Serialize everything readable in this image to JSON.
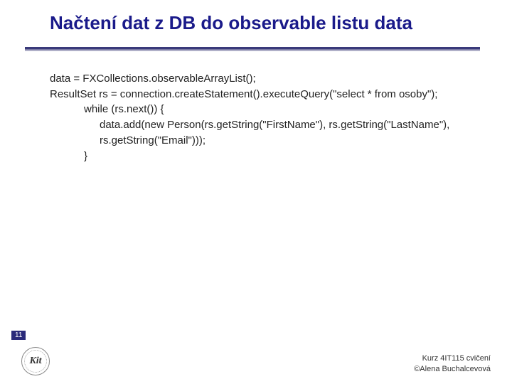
{
  "title": "Načtení dat z DB do observable listu data",
  "code": {
    "line1": "data = FXCollections.observableArrayList();",
    "line2": "ResultSet rs = connection.createStatement().executeQuery(\"select * from osoby\");",
    "line3": "while (rs.next()) {",
    "line4": "data.add(new Person(rs.getString(\"FirstName\"), rs.getString(\"LastName\"), rs.getString(\"Email\")));",
    "line5": "}"
  },
  "page_number": "11",
  "logo_text": "Kit",
  "footer": {
    "line1": "Kurz 4IT115 cvičení",
    "line2": "©Alena Buchalcevová"
  }
}
